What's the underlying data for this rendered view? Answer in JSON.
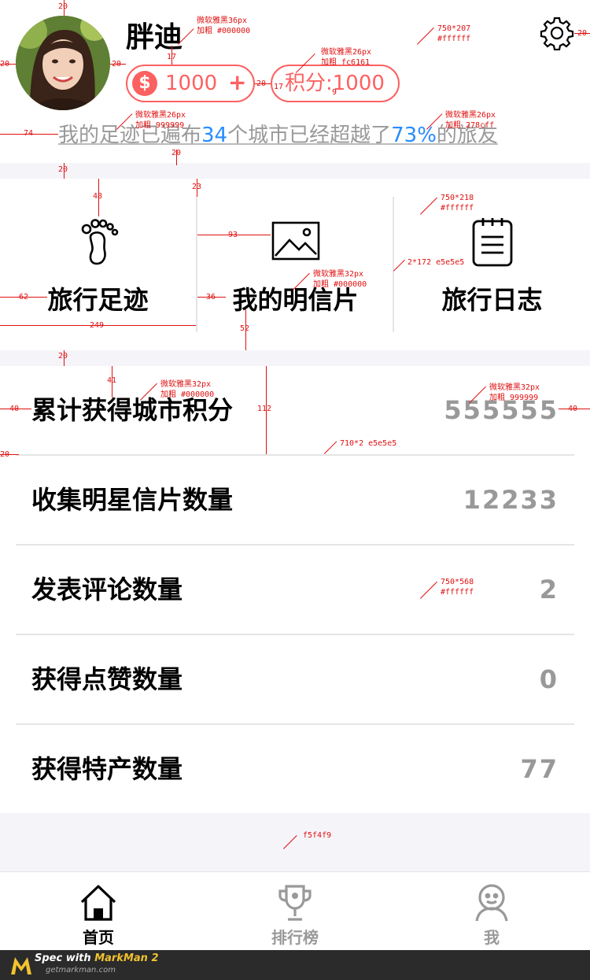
{
  "header": {
    "username": "胖迪",
    "coins": "1000",
    "coin_symbol": "$",
    "plus": "+",
    "points_label": "积分:1000",
    "footprint": {
      "part1": "我的足迹已遍布",
      "cities": "34",
      "part2": "个城市已经超越了",
      "percent": "73%",
      "part3": "的旅友"
    }
  },
  "features": [
    {
      "label": "旅行足迹",
      "icon": "footprint-icon"
    },
    {
      "label": "我的明信片",
      "icon": "image-icon"
    },
    {
      "label": "旅行日志",
      "icon": "notepad-icon"
    }
  ],
  "stats": [
    {
      "label": "累计获得城市积分",
      "value": "555555"
    },
    {
      "label": "收集明星信片数量",
      "value": "12233"
    },
    {
      "label": "发表评论数量",
      "value": "2"
    },
    {
      "label": "获得点赞数量",
      "value": "0"
    },
    {
      "label": "获得特产数量",
      "value": "77"
    }
  ],
  "tabs": [
    {
      "label": "首页",
      "icon": "home-icon",
      "active": true
    },
    {
      "label": "排行榜",
      "icon": "trophy-icon",
      "active": false
    },
    {
      "label": "我",
      "icon": "user-icon",
      "active": false
    }
  ],
  "colors": {
    "accent_red": "#fc6161",
    "accent_blue": "#278cff",
    "muted": "#999999",
    "divider": "#e5e5e5",
    "page_bg": "#f5f4f9"
  },
  "annotations": {
    "a1": "微软雅黑36px\n加粗 #000000",
    "a2": "750*207\n#ffffff",
    "a3": "微软雅黑26px\n加粗 fc6161",
    "a4": "微软雅黑26px\n加粗 999999",
    "a5": "微软雅黑26px\n加粗 278cff",
    "a6": "750*218\n#ffffff",
    "a7": "2*172 e5e5e5",
    "a8": "微软雅黑32px\n加粗 #000000",
    "a9": "微软雅黑32px\n加粗 #000000",
    "a10": "微软雅黑32px\n加粗 999999",
    "a11": "710*2 e5e5e5",
    "a12": "750*568\n#ffffff",
    "a13": "f5f4f9",
    "d20a": "20",
    "d17": "17",
    "d20b": "20",
    "d20c": "20",
    "d20d": "20",
    "d17b": "17",
    "d9": "9",
    "d20e": "20",
    "d74": "74",
    "d20f": "20",
    "d20g": "20",
    "d48": "48",
    "d23": "23",
    "d93": "93",
    "d62": "62",
    "d36": "36",
    "d249": "249",
    "d52": "52",
    "d20h": "20",
    "d41": "41",
    "d40": "40",
    "d112": "112",
    "d40b": "40",
    "d20i": "20"
  },
  "markman": {
    "line1_prefix": "Spec with ",
    "line1_brand": "MarkMan 2",
    "line2": "getmarkman.com"
  }
}
